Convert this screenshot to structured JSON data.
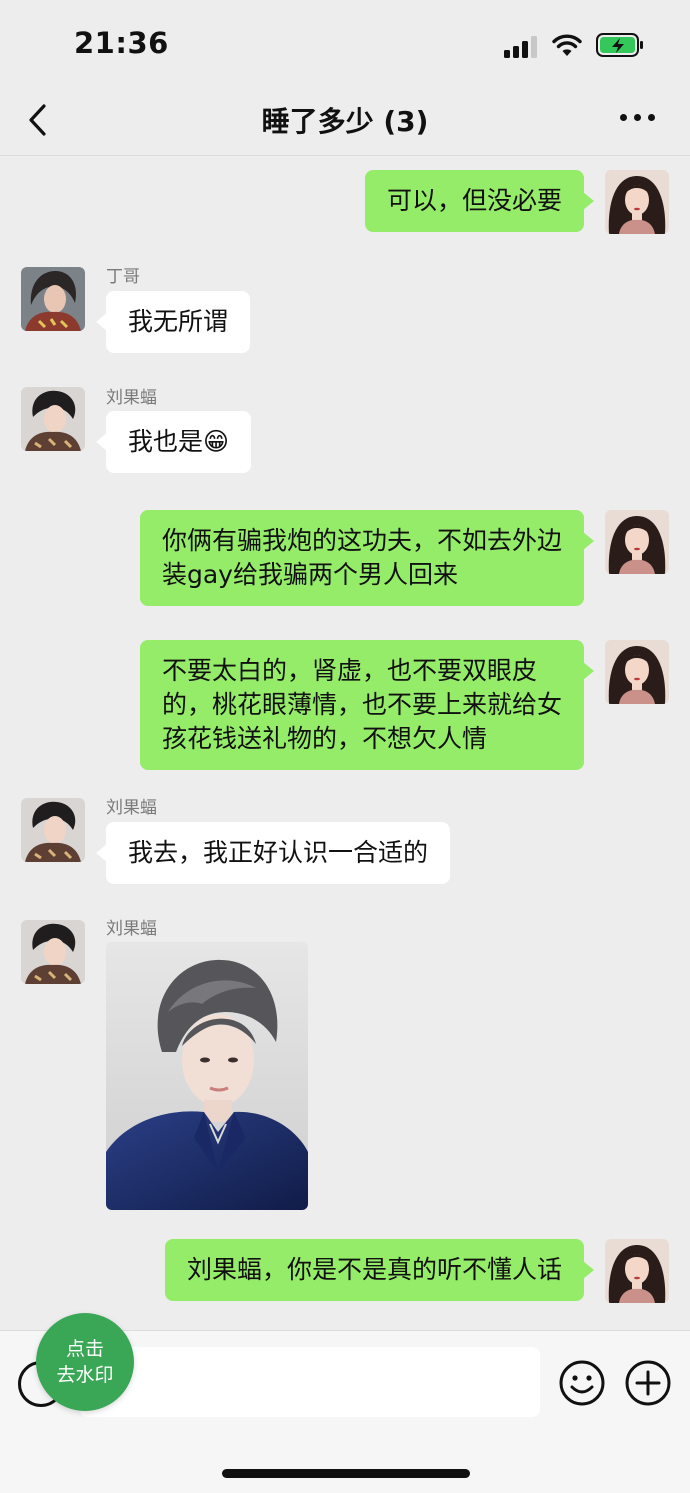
{
  "status_bar": {
    "time": "21:36"
  },
  "nav": {
    "title": "睡了多少 (3)"
  },
  "messages": [
    {
      "side": "me",
      "text": "可以，但没必要"
    },
    {
      "side": "other",
      "sender": "丁哥",
      "text": "我无所谓"
    },
    {
      "side": "other",
      "sender": "刘果蝠",
      "text": "我也是😁"
    },
    {
      "side": "me",
      "lines": [
        "你俩有骗我炮的这功夫，不如去外边",
        "装gay给我骗两个男人回来"
      ]
    },
    {
      "side": "me",
      "lines": [
        "不要太白的，肾虚，也不要双眼皮",
        "的，桃花眼薄情，也不要上来就给女",
        "孩花钱送礼物的，不想欠人情"
      ]
    },
    {
      "side": "other",
      "sender": "刘果蝠",
      "text": "我去，我正好认识一合适的"
    },
    {
      "side": "other",
      "sender": "刘果蝠",
      "type": "image",
      "image_desc": "young man with tousled gray hair in navy velvet suit"
    },
    {
      "side": "me",
      "text": "刘果蝠，你是不是真的听不懂人话"
    }
  ],
  "watermark_button": {
    "line1": "点击",
    "line2": "去水印"
  },
  "icons": {
    "back": "chevron-left-icon",
    "more": "more-dots-icon",
    "voice": "voice-icon",
    "emoji": "emoji-icon",
    "plus": "plus-icon"
  },
  "colors": {
    "my_bubble": "#95ec69",
    "other_bubble": "#ffffff",
    "background": "#ededed",
    "watermark_button": "#3aa757"
  }
}
